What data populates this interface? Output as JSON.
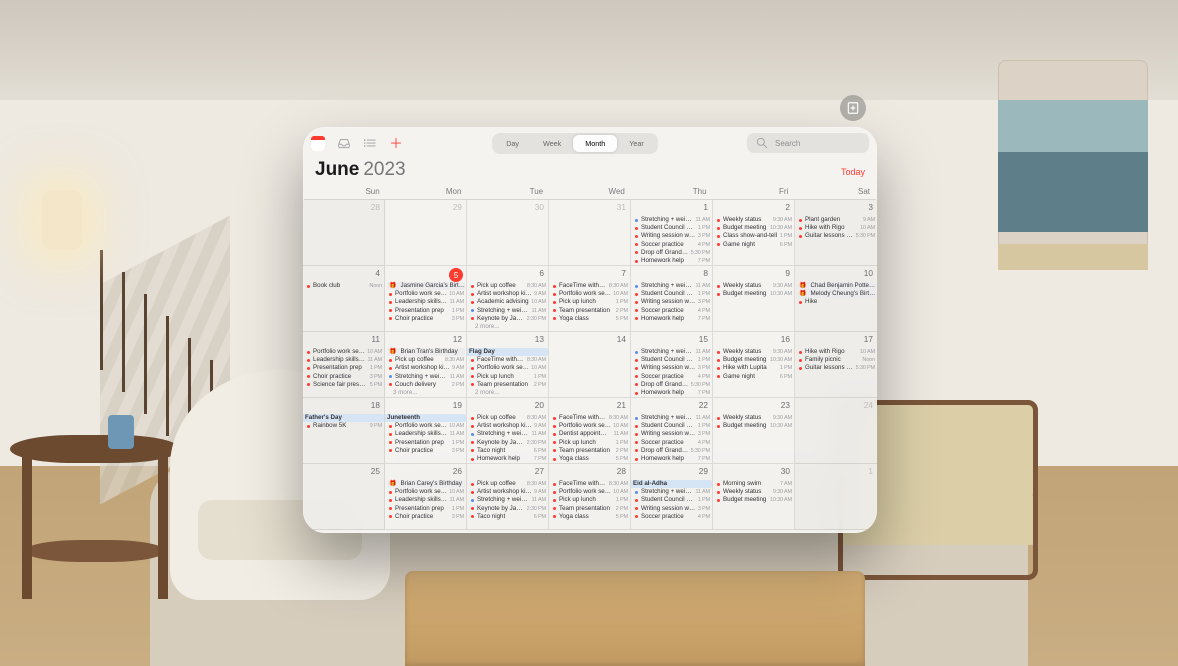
{
  "view_tabs": [
    "Day",
    "Week",
    "Month",
    "Year"
  ],
  "active_tab": "Month",
  "search_placeholder": "Search",
  "month": "June",
  "year": "2023",
  "today_label": "Today",
  "dow": [
    "Sun",
    "Mon",
    "Tue",
    "Wed",
    "Thu",
    "Fri",
    "Sat"
  ],
  "more_fmt": "{n} more...",
  "cells": [
    {
      "d": 28,
      "off": true,
      "wk": true,
      "ev": []
    },
    {
      "d": 29,
      "off": true,
      "ev": []
    },
    {
      "d": 30,
      "off": true,
      "ev": []
    },
    {
      "d": 31,
      "off": true,
      "ev": []
    },
    {
      "d": 1,
      "ev": [
        {
          "c": "blue",
          "t": "Stretching + weights",
          "tm": "11 AM"
        },
        {
          "c": "red",
          "t": "Student Council meeting",
          "tm": "1 PM"
        },
        {
          "c": "red",
          "t": "Writing session with A...",
          "tm": "3 PM"
        },
        {
          "c": "red",
          "t": "Soccer practice",
          "tm": "4 PM"
        },
        {
          "c": "red",
          "t": "Drop off Grandma's...",
          "tm": "5:30 PM"
        },
        {
          "c": "red",
          "t": "Homework help",
          "tm": "7 PM"
        }
      ]
    },
    {
      "d": 2,
      "ev": [
        {
          "c": "red",
          "t": "Weekly status",
          "tm": "9:30 AM"
        },
        {
          "c": "red",
          "t": "Budget meeting",
          "tm": "10:30 AM"
        },
        {
          "c": "red",
          "t": "Class show-and-tell",
          "tm": "1 PM"
        },
        {
          "c": "red",
          "t": "Game night",
          "tm": "6 PM"
        }
      ]
    },
    {
      "d": 3,
      "wk": true,
      "ev": [
        {
          "c": "red",
          "t": "Plant garden",
          "tm": "9 AM"
        },
        {
          "c": "red",
          "t": "Hike with Rigo",
          "tm": "10 AM"
        },
        {
          "c": "red",
          "t": "Guitar lessons with...",
          "tm": "5:30 PM"
        }
      ]
    },
    {
      "d": 4,
      "wk": true,
      "ev": [
        {
          "c": "red",
          "t": "Book club",
          "tm": "Noon"
        }
      ]
    },
    {
      "d": 5,
      "today": true,
      "ev": [
        {
          "bd": true,
          "t": "Jasmine Garcia's Birthday"
        },
        {
          "c": "red",
          "t": "Portfolio work session",
          "tm": "10 AM"
        },
        {
          "c": "red",
          "t": "Leadership skills work...",
          "tm": "11 AM"
        },
        {
          "c": "red",
          "t": "Presentation prep",
          "tm": "1 PM"
        },
        {
          "c": "red",
          "t": "Choir practice",
          "tm": "3 PM"
        }
      ]
    },
    {
      "d": 6,
      "ev": [
        {
          "c": "red",
          "t": "Pick up coffee",
          "tm": "8:30 AM"
        },
        {
          "c": "red",
          "t": "Artist workshop kickoff",
          "tm": "9 AM"
        },
        {
          "c": "red",
          "t": "Academic advising",
          "tm": "10 AM"
        },
        {
          "c": "blue",
          "t": "Stretching + weights",
          "tm": "11 AM"
        },
        {
          "c": "red",
          "t": "Keynote by Jasmine",
          "tm": "2:30 PM"
        }
      ],
      "more": 2
    },
    {
      "d": 7,
      "ev": [
        {
          "c": "red",
          "t": "FaceTime with Gran...",
          "tm": "8:30 AM"
        },
        {
          "c": "red",
          "t": "Portfolio work session",
          "tm": "10 AM"
        },
        {
          "c": "red",
          "t": "Pick up lunch",
          "tm": "1 PM"
        },
        {
          "c": "red",
          "t": "Team presentation",
          "tm": "2 PM"
        },
        {
          "c": "red",
          "t": "Yoga class",
          "tm": "5 PM"
        }
      ]
    },
    {
      "d": 8,
      "ev": [
        {
          "c": "blue",
          "t": "Stretching + weights",
          "tm": "11 AM"
        },
        {
          "c": "red",
          "t": "Student Council meeting",
          "tm": "1 PM"
        },
        {
          "c": "red",
          "t": "Writing session with A...",
          "tm": "3 PM"
        },
        {
          "c": "red",
          "t": "Soccer practice",
          "tm": "4 PM"
        },
        {
          "c": "red",
          "t": "Homework help",
          "tm": "7 PM"
        }
      ]
    },
    {
      "d": 9,
      "ev": [
        {
          "c": "red",
          "t": "Weekly status",
          "tm": "9:30 AM"
        },
        {
          "c": "red",
          "t": "Budget meeting",
          "tm": "10:30 AM"
        }
      ]
    },
    {
      "d": 10,
      "wk": true,
      "ev": [
        {
          "bd": true,
          "t": "Chad Benjamin Potter's Bi..."
        },
        {
          "bd": true,
          "t": "Melody Cheung's Birthday"
        },
        {
          "c": "red",
          "t": "Hike",
          "tm": ""
        }
      ]
    },
    {
      "d": 11,
      "wk": true,
      "ev": [
        {
          "c": "red",
          "t": "Portfolio work session",
          "tm": "10 AM"
        },
        {
          "c": "red",
          "t": "Leadership skills work...",
          "tm": "11 AM"
        },
        {
          "c": "red",
          "t": "Presentation prep",
          "tm": "1 PM"
        },
        {
          "c": "red",
          "t": "Choir practice",
          "tm": "3 PM"
        },
        {
          "c": "red",
          "t": "Science fair presentati...",
          "tm": "5 PM"
        }
      ]
    },
    {
      "d": 12,
      "ev": [
        {
          "bd": true,
          "t": "Brian Tran's Birthday"
        },
        {
          "c": "red",
          "t": "Pick up coffee",
          "tm": "8:30 AM"
        },
        {
          "c": "red",
          "t": "Artist workshop kickoff",
          "tm": "9 AM"
        },
        {
          "c": "blue",
          "t": "Stretching + weights",
          "tm": "11 AM"
        },
        {
          "c": "red",
          "t": "Couch delivery",
          "tm": "2 PM"
        }
      ],
      "more": 3
    },
    {
      "d": 13,
      "ev": [
        {
          "hol": true,
          "t": "Flag Day"
        },
        {
          "c": "red",
          "t": "FaceTime with Gran...",
          "tm": "8:30 AM"
        },
        {
          "c": "red",
          "t": "Portfolio work session",
          "tm": "10 AM"
        },
        {
          "c": "red",
          "t": "Pick up lunch",
          "tm": "1 PM"
        },
        {
          "c": "red",
          "t": "Team presentation",
          "tm": "2 PM"
        }
      ],
      "more": 2
    },
    {
      "d": 14,
      "ev": []
    },
    {
      "d": 15,
      "ev": [
        {
          "c": "blue",
          "t": "Stretching + weights",
          "tm": "11 AM"
        },
        {
          "c": "red",
          "t": "Student Council meeting",
          "tm": "1 PM"
        },
        {
          "c": "red",
          "t": "Writing session with A...",
          "tm": "3 PM"
        },
        {
          "c": "red",
          "t": "Soccer practice",
          "tm": "4 PM"
        },
        {
          "c": "red",
          "t": "Drop off Grandma's...",
          "tm": "5:30 PM"
        },
        {
          "c": "red",
          "t": "Homework help",
          "tm": "7 PM"
        }
      ]
    },
    {
      "d": 16,
      "ev": [
        {
          "c": "red",
          "t": "Weekly status",
          "tm": "9:30 AM"
        },
        {
          "c": "red",
          "t": "Budget meeting",
          "tm": "10:30 AM"
        },
        {
          "c": "red",
          "t": "Hike with Lupita",
          "tm": "1 PM"
        },
        {
          "c": "red",
          "t": "Game night",
          "tm": "6 PM"
        }
      ]
    },
    {
      "d": 17,
      "wk": true,
      "ev": [
        {
          "c": "red",
          "t": "Hike with Rigo",
          "tm": "10 AM"
        },
        {
          "c": "red",
          "t": "Family picnic",
          "tm": "Noon"
        },
        {
          "c": "red",
          "t": "Guitar lessons with...",
          "tm": "5:30 PM"
        }
      ]
    },
    {
      "d": 18,
      "wk": true,
      "ev": [
        {
          "hol": true,
          "t": "Father's Day"
        },
        {
          "c": "red",
          "t": "Rainbow 5K",
          "tm": "9 PM"
        }
      ]
    },
    {
      "d": 19,
      "ev": [
        {
          "hol": true,
          "t": "Juneteenth"
        },
        {
          "c": "red",
          "t": "Portfolio work session",
          "tm": "10 AM"
        },
        {
          "c": "red",
          "t": "Leadership skills work...",
          "tm": "11 AM"
        },
        {
          "c": "red",
          "t": "Presentation prep",
          "tm": "1 PM"
        },
        {
          "c": "red",
          "t": "Choir practice",
          "tm": "3 PM"
        }
      ]
    },
    {
      "d": 20,
      "ev": [
        {
          "c": "red",
          "t": "Pick up coffee",
          "tm": "8:30 AM"
        },
        {
          "c": "red",
          "t": "Artist workshop kickoff",
          "tm": "9 AM"
        },
        {
          "c": "blue",
          "t": "Stretching + weights",
          "tm": "11 AM"
        },
        {
          "c": "red",
          "t": "Keynote by Jasmine",
          "tm": "2:30 PM"
        },
        {
          "c": "red",
          "t": "Taco night",
          "tm": "6 PM"
        },
        {
          "c": "red",
          "t": "Homework help",
          "tm": "7 PM"
        }
      ]
    },
    {
      "d": 21,
      "ev": [
        {
          "c": "red",
          "t": "FaceTime with Gran...",
          "tm": "8:30 AM"
        },
        {
          "c": "red",
          "t": "Portfolio work session",
          "tm": "10 AM"
        },
        {
          "c": "red",
          "t": "Dentist appointment",
          "tm": "11 AM"
        },
        {
          "c": "red",
          "t": "Pick up lunch",
          "tm": "1 PM"
        },
        {
          "c": "red",
          "t": "Team presentation",
          "tm": "2 PM"
        },
        {
          "c": "red",
          "t": "Yoga class",
          "tm": "5 PM"
        }
      ]
    },
    {
      "d": 22,
      "ev": [
        {
          "c": "blue",
          "t": "Stretching + weights",
          "tm": "11 AM"
        },
        {
          "c": "red",
          "t": "Student Council meeting",
          "tm": "1 PM"
        },
        {
          "c": "red",
          "t": "Writing session with A...",
          "tm": "3 PM"
        },
        {
          "c": "red",
          "t": "Soccer practice",
          "tm": "4 PM"
        },
        {
          "c": "red",
          "t": "Drop off Grandma's...",
          "tm": "5:30 PM"
        },
        {
          "c": "red",
          "t": "Homework help",
          "tm": "7 PM"
        }
      ]
    },
    {
      "d": 23,
      "ev": [
        {
          "c": "red",
          "t": "Weekly status",
          "tm": "9:30 AM"
        },
        {
          "c": "red",
          "t": "Budget meeting",
          "tm": "10:30 AM"
        }
      ]
    },
    {
      "d": 24,
      "wk": true,
      "off": true,
      "ev": []
    },
    {
      "d": 25,
      "wk": true,
      "ev": []
    },
    {
      "d": 26,
      "ev": [
        {
          "bd": true,
          "t": "Brian Carey's Birthday"
        },
        {
          "c": "red",
          "t": "Portfolio work session",
          "tm": "10 AM"
        },
        {
          "c": "red",
          "t": "Leadership skills work...",
          "tm": "11 AM"
        },
        {
          "c": "red",
          "t": "Presentation prep",
          "tm": "1 PM"
        },
        {
          "c": "red",
          "t": "Choir practice",
          "tm": "3 PM"
        }
      ]
    },
    {
      "d": 27,
      "ev": [
        {
          "c": "red",
          "t": "Pick up coffee",
          "tm": "8:30 AM"
        },
        {
          "c": "red",
          "t": "Artist workshop kickoff",
          "tm": "9 AM"
        },
        {
          "c": "blue",
          "t": "Stretching + weights",
          "tm": "11 AM"
        },
        {
          "c": "red",
          "t": "Keynote by Jasmine",
          "tm": "2:30 PM"
        },
        {
          "c": "red",
          "t": "Taco night",
          "tm": "6 PM"
        }
      ]
    },
    {
      "d": 28,
      "ev": [
        {
          "c": "red",
          "t": "FaceTime with Gran...",
          "tm": "8:30 AM"
        },
        {
          "c": "red",
          "t": "Portfolio work session",
          "tm": "10 AM"
        },
        {
          "c": "red",
          "t": "Pick up lunch",
          "tm": "1 PM"
        },
        {
          "c": "red",
          "t": "Team presentation",
          "tm": "2 PM"
        },
        {
          "c": "red",
          "t": "Yoga class",
          "tm": "5 PM"
        }
      ]
    },
    {
      "d": 29,
      "ev": [
        {
          "hol": true,
          "t": "Eid al-Adha"
        },
        {
          "c": "blue",
          "t": "Stretching + weights",
          "tm": "11 AM"
        },
        {
          "c": "red",
          "t": "Student Council meeting",
          "tm": "1 PM"
        },
        {
          "c": "red",
          "t": "Writing session with A...",
          "tm": "3 PM"
        },
        {
          "c": "red",
          "t": "Soccer practice",
          "tm": "4 PM"
        }
      ]
    },
    {
      "d": 30,
      "ev": [
        {
          "c": "red",
          "t": "Morning swim",
          "tm": "7 AM"
        },
        {
          "c": "red",
          "t": "Weekly status",
          "tm": "9:30 AM"
        },
        {
          "c": "red",
          "t": "Budget meeting",
          "tm": "10:30 AM"
        }
      ]
    },
    {
      "d": 1,
      "off": true,
      "wk": true,
      "ev": []
    }
  ]
}
